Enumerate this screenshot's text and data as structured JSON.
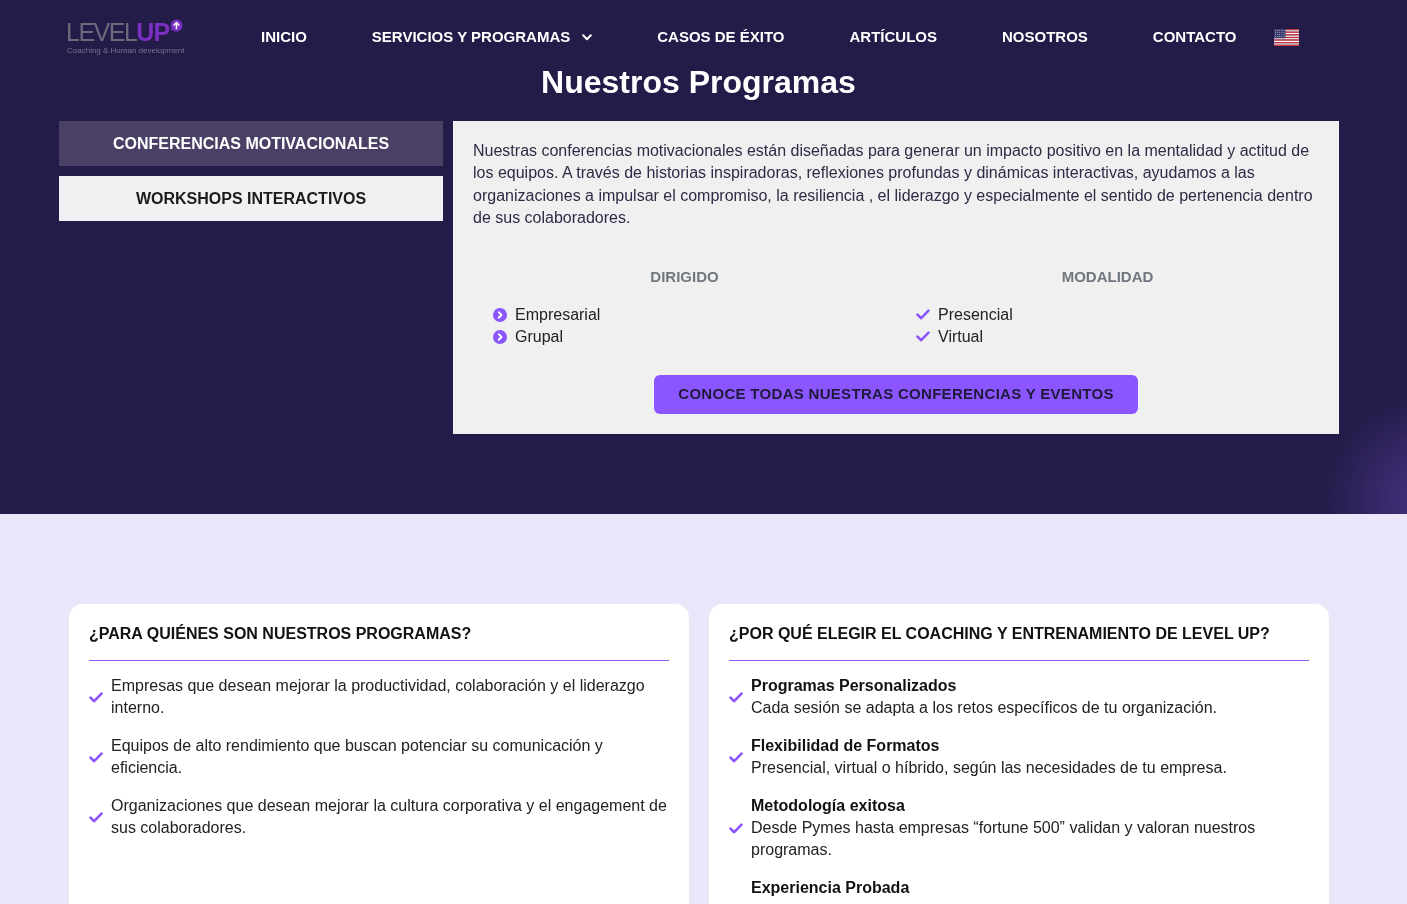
{
  "header": {
    "logo": {
      "light_part": "LEVEL",
      "accent_part": "UP",
      "tagline": "Coaching & Human development"
    },
    "nav": [
      {
        "label": "INICIO",
        "dropdown": false
      },
      {
        "label": "SERVICIOS Y PROGRAMAS",
        "dropdown": true
      },
      {
        "label": "CASOS DE ÉXITO",
        "dropdown": false
      },
      {
        "label": "ARTÍCULOS",
        "dropdown": false
      },
      {
        "label": "NOSOTROS",
        "dropdown": false
      },
      {
        "label": "CONTACTO",
        "dropdown": false
      }
    ]
  },
  "programs": {
    "title": "Nuestros Programas",
    "tabs": [
      {
        "label": "CONFERENCIAS MOTIVACIONALES",
        "selected": true
      },
      {
        "label": "WORKSHOPS INTERACTIVOS",
        "selected": false
      }
    ],
    "panel": {
      "description": "Nuestras conferencias motivacionales están diseñadas para generar un impacto positivo en la mentalidad y actitud de los equipos. A través de historias inspiradoras, reflexiones profundas y dinámicas interactivas, ayudamos a las organizaciones a impulsar el compromiso, la resiliencia , el liderazgo y especialmente el sentido de pertenencia dentro de sus colaboradores.",
      "columns": [
        {
          "heading": "DIRIGIDO",
          "kind": "chevron",
          "items": [
            "Empresarial",
            "Grupal"
          ]
        },
        {
          "heading": "MODALIDAD",
          "kind": "check",
          "items": [
            "Presencial",
            "Virtual"
          ]
        }
      ],
      "button": "CONOCE TODAS NUESTRAS CONFERENCIAS Y EVENTOS"
    }
  },
  "audience_card": {
    "title": "¿PARA QUIÉNES SON NUESTROS PROGRAMAS?",
    "items": [
      "Empresas que desean mejorar la productividad, colaboración y el liderazgo interno.",
      "Equipos de alto rendimiento que buscan potenciar su comunicación y eficiencia.",
      "Organizaciones que desean mejorar la cultura corporativa y el engagement de sus colaboradores."
    ]
  },
  "reasons_card": {
    "title": "¿POR QUÉ ELEGIR EL COACHING Y ENTRENAMIENTO DE LEVEL UP?",
    "items": [
      {
        "title": "Programas Personalizados",
        "text": "Cada sesión se adapta a los retos específicos de tu organización."
      },
      {
        "title": "Flexibilidad de Formatos",
        "text": "Presencial, virtual o híbrido, según las necesidades de tu empresa."
      },
      {
        "title": "Metodología exitosa",
        "text": "Desde Pymes hasta empresas “fortune 500” validan y valoran nuestros programas."
      },
      {
        "title": "Experiencia Probada"
      }
    ]
  }
}
